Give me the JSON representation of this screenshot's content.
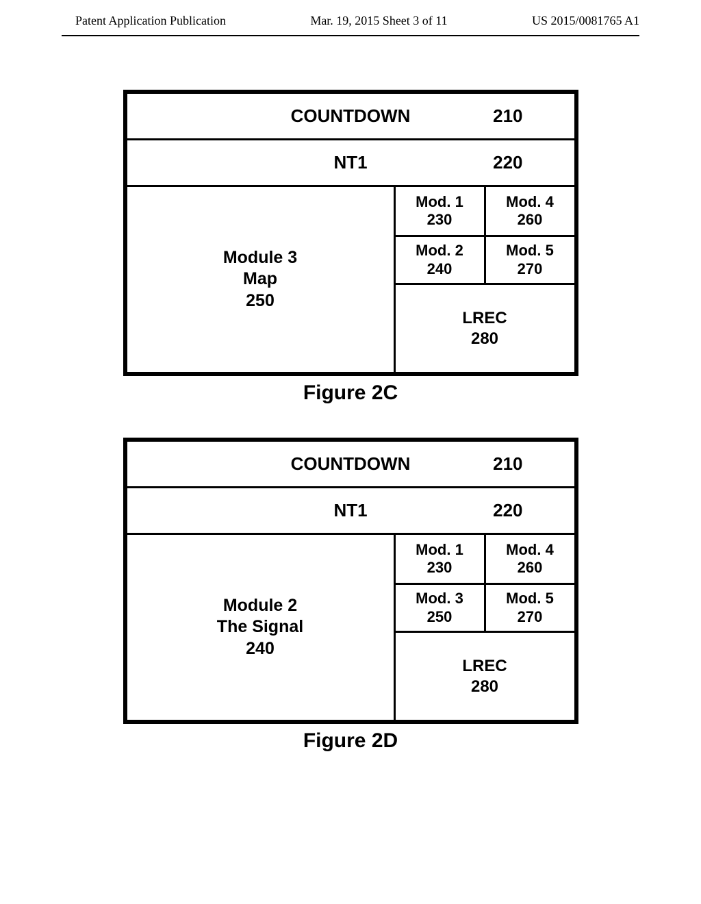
{
  "header": {
    "left": "Patent Application Publication",
    "center": "Mar. 19, 2015  Sheet 3 of 11",
    "right": "US 2015/0081765 A1"
  },
  "figures": [
    {
      "caption": "Figure 2C",
      "row1": {
        "label": "COUNTDOWN",
        "num": "210"
      },
      "row2": {
        "label": "NT1",
        "num": "220"
      },
      "left_panel": {
        "line1": "Module 3",
        "line2": "Map",
        "line3": "250"
      },
      "mods": [
        {
          "a_label": "Mod. 1",
          "a_num": "230",
          "b_label": "Mod. 4",
          "b_num": "260"
        },
        {
          "a_label": "Mod. 2",
          "a_num": "240",
          "b_label": "Mod. 5",
          "b_num": "270"
        }
      ],
      "lrec": {
        "label": "LREC",
        "num": "280"
      }
    },
    {
      "caption": "Figure 2D",
      "row1": {
        "label": "COUNTDOWN",
        "num": "210"
      },
      "row2": {
        "label": "NT1",
        "num": "220"
      },
      "left_panel": {
        "line1": "Module 2",
        "line2": "The Signal",
        "line3": "240"
      },
      "mods": [
        {
          "a_label": "Mod. 1",
          "a_num": "230",
          "b_label": "Mod. 4",
          "b_num": "260"
        },
        {
          "a_label": "Mod. 3",
          "a_num": "250",
          "b_label": "Mod. 5",
          "b_num": "270"
        }
      ],
      "lrec": {
        "label": "LREC",
        "num": "280"
      }
    }
  ]
}
